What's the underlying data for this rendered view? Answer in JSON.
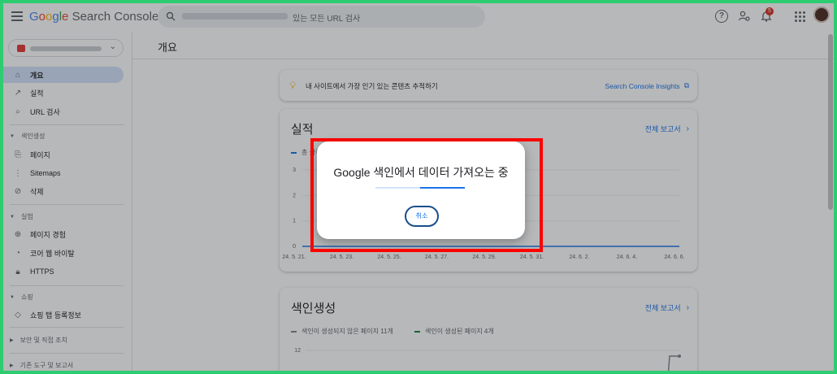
{
  "header": {
    "logo_word": "Google",
    "logo_product": "Search Console",
    "search_placeholder": "있는 모든 URL 검사",
    "notification_count": "5"
  },
  "sidebar": {
    "items_top": [
      {
        "label": "개요",
        "icon": "home-icon",
        "active": true
      },
      {
        "label": "실적",
        "icon": "trending-up-icon"
      },
      {
        "label": "URL 검사",
        "icon": "search-icon"
      }
    ],
    "section_index": "색인생성",
    "items_index": [
      {
        "label": "페이지",
        "icon": "pages-icon"
      },
      {
        "label": "Sitemaps",
        "icon": "sitemap-icon"
      },
      {
        "label": "삭제",
        "icon": "eye-off-icon"
      }
    ],
    "section_experience": "실험",
    "items_experience": [
      {
        "label": "페이지 경험",
        "icon": "plus-circle-icon"
      },
      {
        "label": "코어 웹 바이탈",
        "icon": "gauge-icon"
      },
      {
        "label": "HTTPS",
        "icon": "lock-icon"
      }
    ],
    "section_shopping": "쇼핑",
    "items_shopping": [
      {
        "label": "쇼핑 탭 등록정보",
        "icon": "tag-icon"
      }
    ],
    "section_security": "보안 및 직접 조치",
    "section_legacy": "기존 도구 및 보고서"
  },
  "main": {
    "page_title": "개요",
    "tip_text": "내 사이트에서 가장 인기 있는 콘텐츠 추적하기",
    "tip_link": "Search Console Insights",
    "performance": {
      "title": "실적",
      "link": "전체 보고서",
      "legend": "총 클릭수"
    },
    "indexing": {
      "title": "색인생성",
      "link": "전체 보고서",
      "legend_unindexed": "색인이 생성되지 않은 페이지 11개",
      "legend_indexed": "색인이 생성된 페이지 4개"
    }
  },
  "dialog": {
    "title": "Google 색인에서 데이터 가져오는 중",
    "cancel": "취소",
    "progress": 0.5
  },
  "colors": {
    "accent": "#1a73e8",
    "highlight": "#ff0000",
    "indexed": "#188038",
    "unindexed": "#80868b"
  },
  "chart_data": [
    {
      "type": "line",
      "title": "실적",
      "series": [
        {
          "name": "총 클릭수",
          "values": [
            0,
            0,
            0,
            0,
            0,
            0,
            0,
            0,
            0,
            0,
            0,
            0,
            0,
            0,
            0,
            0,
            0
          ]
        }
      ],
      "x": [
        "24. 5. 21.",
        "24. 5. 23.",
        "24. 5. 25.",
        "24. 5. 27.",
        "24. 5. 29.",
        "24. 5. 31.",
        "24. 6. 2.",
        "24. 6. 4.",
        "24. 6. 6."
      ],
      "y_ticks": [
        "0",
        "1",
        "2",
        "3"
      ],
      "ylim": [
        0,
        3
      ]
    },
    {
      "type": "line",
      "title": "색인생성",
      "series": [
        {
          "name": "색인이 생성되지 않은 페이지 11개"
        },
        {
          "name": "색인이 생성된 페이지 4개"
        }
      ],
      "y_ticks": [
        "12"
      ]
    }
  ]
}
